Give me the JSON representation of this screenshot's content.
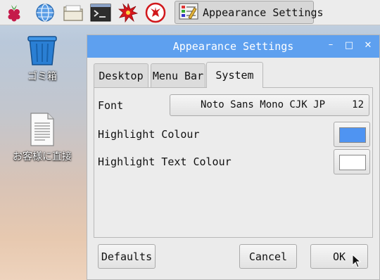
{
  "taskbar": {
    "launchers": [
      {
        "icon": "raspberry-menu-icon"
      },
      {
        "icon": "web-browser-icon"
      },
      {
        "icon": "file-manager-icon"
      },
      {
        "icon": "terminal-icon"
      },
      {
        "icon": "burst-app-icon"
      },
      {
        "icon": "wolfram-icon"
      }
    ],
    "task": {
      "icon": "appearance-settings-icon",
      "label": "Appearance Settings"
    }
  },
  "desktop": {
    "icons": [
      {
        "icon": "trash-icon",
        "label": "ゴミ箱"
      },
      {
        "icon": "document-icon",
        "label": "お客様に直接"
      }
    ]
  },
  "window": {
    "title": "Appearance Settings",
    "controls": {
      "minimize": "–",
      "maximize": "□",
      "close": "✕"
    },
    "tabs": [
      {
        "label": "Desktop",
        "active": false
      },
      {
        "label": "Menu Bar",
        "active": false
      },
      {
        "label": "System",
        "active": true
      }
    ],
    "system": {
      "font_label": "Font",
      "font_name": "Noto Sans Mono CJK JP",
      "font_size": "12",
      "highlight_colour_label": "Highlight Colour",
      "highlight_colour": "#4f94f2",
      "highlight_text_colour_label": "Highlight Text Colour",
      "highlight_text_colour": "#ffffff"
    },
    "buttons": {
      "defaults": "Defaults",
      "cancel": "Cancel",
      "ok": "OK"
    }
  }
}
